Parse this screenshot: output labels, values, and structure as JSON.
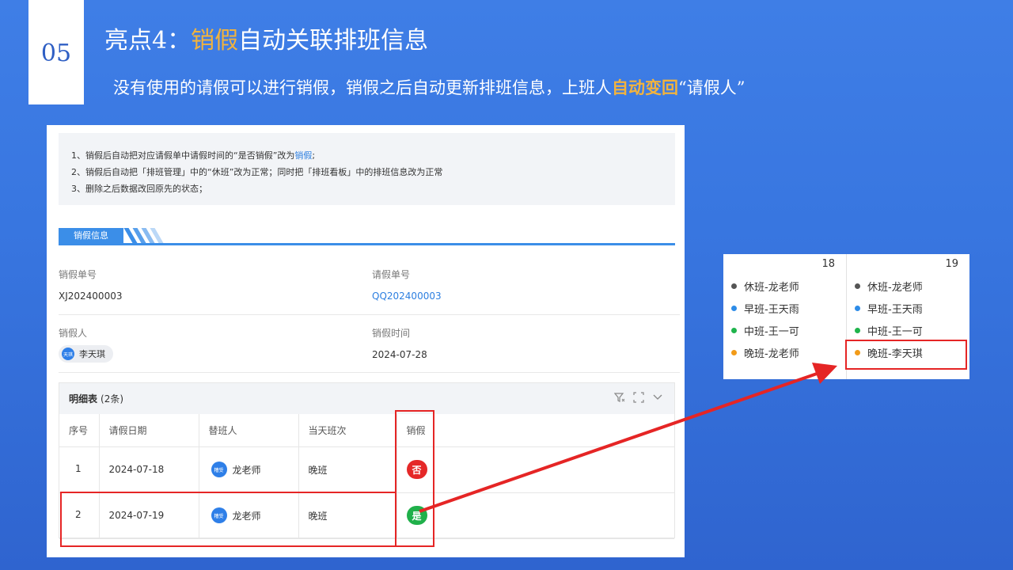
{
  "slide": {
    "number": "05",
    "title_prefix": "亮点4：",
    "title_highlight": "销假",
    "title_suffix": "自动关联排班信息",
    "subtitle_prefix": "没有使用的请假可以进行销假，销假之后自动更新排班信息，上班人",
    "subtitle_highlight": "自动变回",
    "subtitle_suffix": "“请假人”"
  },
  "notes": {
    "line1_prefix": "1、销假后自动把对应请假单中请假时间的“是否销假”改为",
    "line1_link": "销假",
    "line1_suffix": ";",
    "line2": "2、销假后自动把「排班管理」中的“休班”改为正常；同时把「排班看板」中的排班信息改为正常",
    "line3": "3、删除之后数据改回原先的状态；"
  },
  "section": {
    "title": "销假信息"
  },
  "form": {
    "cancel_no_label": "销假单号",
    "cancel_no_value": "XJ202400003",
    "leave_no_label": "请假单号",
    "leave_no_value": "QQ202400003",
    "person_label": "销假人",
    "person_avatar": "天琪",
    "person_name": "李天琪",
    "time_label": "销假时间",
    "time_value": "2024-07-28"
  },
  "detail": {
    "title": "明细表",
    "count": "(2条)",
    "columns": [
      "序号",
      "请假日期",
      "替班人",
      "当天班次",
      "销假"
    ],
    "rows": [
      {
        "idx": "1",
        "date": "2024-07-18",
        "avatar": "糟受",
        "sub": "龙老师",
        "shift": "晚班",
        "cancel": "否"
      },
      {
        "idx": "2",
        "date": "2024-07-19",
        "avatar": "糟受",
        "sub": "龙老师",
        "shift": "晚班",
        "cancel": "是"
      }
    ]
  },
  "calendar": {
    "days": [
      {
        "day": "18",
        "items": [
          "休班-龙老师",
          "早班-王天雨",
          "中班-王一可",
          "晚班-龙老师"
        ]
      },
      {
        "day": "19",
        "items": [
          "休班-龙老师",
          "早班-王天雨",
          "中班-王一可",
          "晚班-李天琪"
        ]
      }
    ],
    "dot_colors": [
      "#555555",
      "#2d8ce8",
      "#1fb44c",
      "#f29b18"
    ]
  },
  "colors": {
    "highlight": "#f2b33d",
    "annotation_red": "#e52525",
    "accent_blue": "#3b8ee8"
  }
}
